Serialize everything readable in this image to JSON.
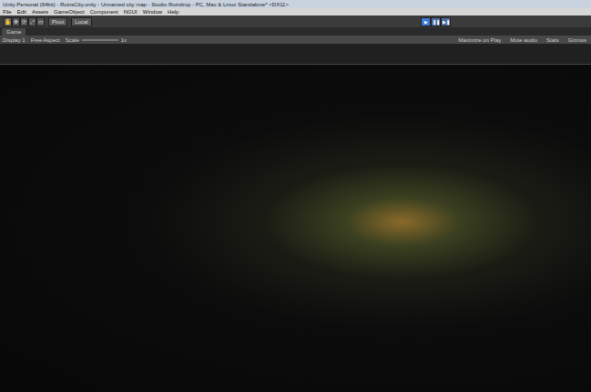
{
  "window": {
    "title": "Unity Personal (64bit) - RuinsCity.unity - Unnamed city map - Studio Ruindrop - PC, Mac & Linux Standalone* <DX11>"
  },
  "menu": [
    "File",
    "Edit",
    "Assets",
    "GameObject",
    "Component",
    "NGUI",
    "Window",
    "Help"
  ],
  "toolbar": {
    "tools": [
      {
        "label": "✋",
        "selected": true
      },
      {
        "label": "✥",
        "selected": false
      },
      {
        "label": "⟳",
        "selected": false
      },
      {
        "label": "⤢",
        "selected": false
      },
      {
        "label": "▭",
        "selected": false
      }
    ],
    "pivot": "Pivot",
    "space": "Local",
    "playback": [
      {
        "label": "▶",
        "selected": true
      },
      {
        "label": "❚❚",
        "selected": false
      },
      {
        "label": "▶❚",
        "selected": false
      }
    ]
  },
  "tabs": [
    {
      "label": "Game",
      "selected": true
    }
  ],
  "game_toolbar": {
    "display": "Display 1",
    "aspect": "Free Aspect",
    "scale_label": "Scale",
    "scale_value": "1x",
    "toggles": [
      {
        "label": "Maximize on Play",
        "selected": false
      },
      {
        "label": "Mute audio",
        "selected": false
      },
      {
        "label": "Stats",
        "selected": false
      },
      {
        "label": "Gizmos",
        "selected": false
      }
    ]
  }
}
